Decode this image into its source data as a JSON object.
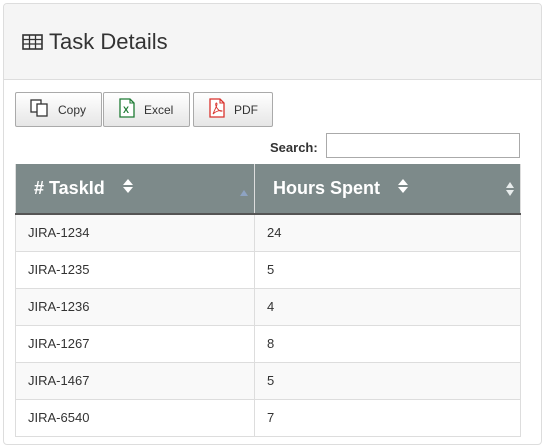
{
  "panel": {
    "title": "Task Details",
    "icon": "table-grid-icon"
  },
  "toolbar": {
    "copy_label": "Copy",
    "excel_label": "Excel",
    "pdf_label": "PDF"
  },
  "search": {
    "label": "Search:",
    "value": ""
  },
  "table": {
    "columns": [
      {
        "label": "# TaskId"
      },
      {
        "label": "Hours Spent"
      }
    ],
    "rows": [
      {
        "task": "JIRA-1234",
        "hours": "24"
      },
      {
        "task": "JIRA-1235",
        "hours": "5"
      },
      {
        "task": "JIRA-1236",
        "hours": "4"
      },
      {
        "task": "JIRA-1267",
        "hours": "8"
      },
      {
        "task": "JIRA-1467",
        "hours": "5"
      },
      {
        "task": "JIRA-6540",
        "hours": "7"
      }
    ]
  },
  "colors": {
    "header_bg": "#7d8a8a",
    "panel_heading_bg": "#f5f5f5",
    "row_stripe": "#f9f9f9",
    "excel_green": "#1e7b34",
    "pdf_red": "#d9322d"
  }
}
